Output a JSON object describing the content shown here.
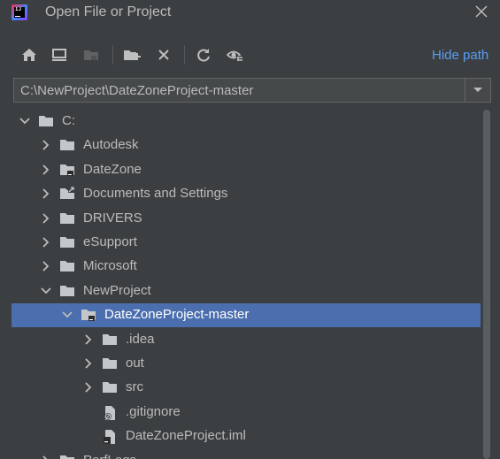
{
  "window": {
    "title": "Open File or Project",
    "close_icon": "close-icon"
  },
  "toolbar": {
    "buttons": [
      {
        "name": "home-icon"
      },
      {
        "name": "desktop-icon"
      },
      {
        "name": "project-folder-icon"
      },
      {
        "name": "new-folder-icon"
      },
      {
        "name": "delete-icon"
      },
      {
        "name": "refresh-icon"
      },
      {
        "name": "show-hidden-icon"
      }
    ],
    "hide_path_label": "Hide path"
  },
  "path": {
    "value": "C:\\NewProject\\DateZoneProject-master"
  },
  "tree": {
    "items": [
      {
        "label": "C:",
        "depth": 0,
        "expanded": true,
        "arrow": "down",
        "icon": "folder"
      },
      {
        "label": "Autodesk",
        "depth": 1,
        "arrow": "right",
        "icon": "folder"
      },
      {
        "label": "DateZone",
        "depth": 1,
        "arrow": "right",
        "icon": "project-folder"
      },
      {
        "label": "Documents and Settings",
        "depth": 1,
        "arrow": "right",
        "icon": "link-folder"
      },
      {
        "label": "DRIVERS",
        "depth": 1,
        "arrow": "right",
        "icon": "folder"
      },
      {
        "label": "eSupport",
        "depth": 1,
        "arrow": "right",
        "icon": "folder"
      },
      {
        "label": "Microsoft",
        "depth": 1,
        "arrow": "right",
        "icon": "folder"
      },
      {
        "label": "NewProject",
        "depth": 1,
        "arrow": "down",
        "icon": "folder"
      },
      {
        "label": "DateZoneProject-master",
        "depth": 2,
        "arrow": "down",
        "icon": "project-folder",
        "selected": true
      },
      {
        "label": ".idea",
        "depth": 3,
        "arrow": "right",
        "icon": "folder"
      },
      {
        "label": "out",
        "depth": 3,
        "arrow": "right",
        "icon": "folder"
      },
      {
        "label": "src",
        "depth": 3,
        "arrow": "right",
        "icon": "folder"
      },
      {
        "label": ".gitignore",
        "depth": 3,
        "arrow": "none",
        "icon": "ignored-file"
      },
      {
        "label": "DateZoneProject.iml",
        "depth": 3,
        "arrow": "none",
        "icon": "module-file"
      },
      {
        "label": "PerfLogs",
        "depth": 1,
        "arrow": "right",
        "icon": "folder"
      }
    ]
  },
  "colors": {
    "background": "#3c3f41",
    "selection": "#4b6eaf",
    "link": "#589df6",
    "text": "#bbbbbb"
  }
}
